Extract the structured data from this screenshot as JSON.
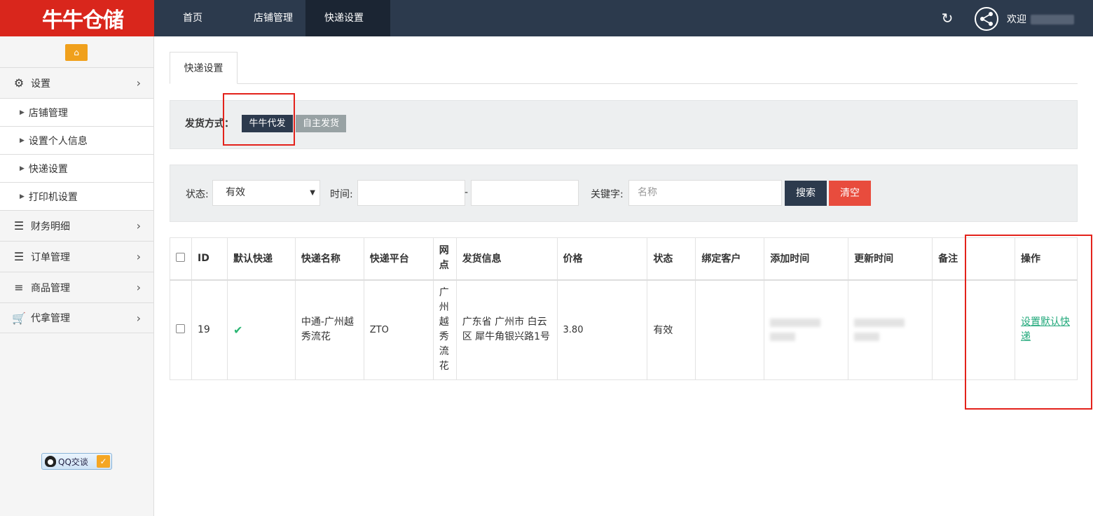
{
  "header": {
    "logo_text": "牛牛仓储",
    "nav": [
      {
        "label": "首页"
      },
      {
        "label": "店铺管理"
      },
      {
        "label": "快递设置",
        "active": true
      }
    ],
    "welcome": "欢迎"
  },
  "sidebar": {
    "menu_settings": "设置",
    "sub_items": [
      "店铺管理",
      "设置个人信息",
      "快递设置",
      "打印机设置"
    ],
    "menu_items": [
      {
        "label": "财务明细",
        "icon": "bars-icon"
      },
      {
        "label": "订单管理",
        "icon": "bars-icon"
      },
      {
        "label": "商品管理",
        "icon": "list-icon"
      },
      {
        "label": "代拿管理",
        "icon": "cart-icon"
      }
    ],
    "qq_label": "QQ交谈"
  },
  "tabs": {
    "active": "快递设置"
  },
  "shipping": {
    "label": "发货方式：",
    "options": [
      "牛牛代发",
      "自主发货"
    ],
    "selected": "牛牛代发"
  },
  "filters": {
    "status_label": "状态:",
    "status_value": "有效",
    "time_label": "时间:",
    "time_sep": "-",
    "keyword_label": "关键字:",
    "keyword_placeholder": "名称",
    "search_button": "搜索",
    "clear_button": "清空"
  },
  "table": {
    "columns": [
      "ID",
      "默认快递",
      "快递名称",
      "快递平台",
      "网点",
      "发货信息",
      "价格",
      "状态",
      "绑定客户",
      "添加时间",
      "更新时间",
      "备注",
      "操作"
    ],
    "rows": [
      {
        "id": "19",
        "default": true,
        "name": "中通-广州越秀流花",
        "platform": "ZTO",
        "outlet": "广州越秀流花",
        "ship_info": "广东省 广州市 白云区 犀牛角银兴路1号",
        "price": "3.80",
        "status": "有效",
        "customer": "",
        "remark": "",
        "action": "设置默认快递"
      }
    ]
  },
  "colors": {
    "topbar": "#2c3a4d",
    "logo_bg": "#d9261c",
    "accent_orange": "#f0a01c",
    "danger": "#e84c3d",
    "link": "#20a87a"
  }
}
